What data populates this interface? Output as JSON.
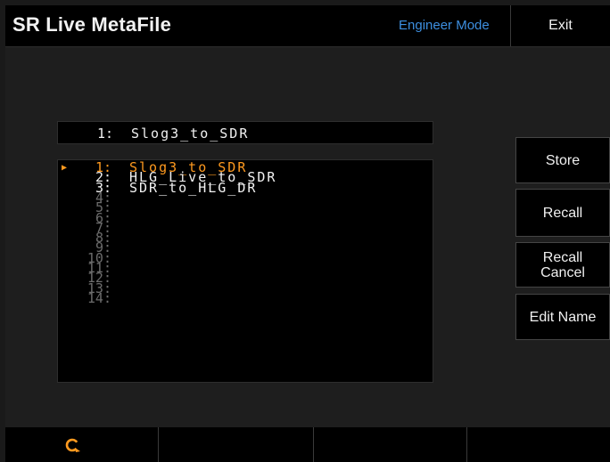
{
  "header": {
    "title": "SR Live MetaFile",
    "mode_label": "Engineer Mode",
    "exit_label": "Exit"
  },
  "current": {
    "number": "1:",
    "name": "Slog3_to_SDR"
  },
  "list": {
    "selected_index": 0,
    "rows": [
      {
        "number": "1:",
        "name": "Slog3_to_SDR"
      },
      {
        "number": "2:",
        "name": "HLG_Live_to_SDR"
      },
      {
        "number": "3:",
        "name": "SDR_to_HLG_DR"
      },
      {
        "number": "4:",
        "name": ""
      },
      {
        "number": "5:",
        "name": ""
      },
      {
        "number": "6:",
        "name": ""
      },
      {
        "number": "7:",
        "name": ""
      },
      {
        "number": "8:",
        "name": ""
      },
      {
        "number": "9:",
        "name": ""
      },
      {
        "number": "10:",
        "name": ""
      },
      {
        "number": "11:",
        "name": ""
      },
      {
        "number": "12:",
        "name": ""
      },
      {
        "number": "13:",
        "name": ""
      },
      {
        "number": "14:",
        "name": ""
      }
    ]
  },
  "side_buttons": {
    "store": "Store",
    "recall": "Recall",
    "recall_cancel_line1": "Recall",
    "recall_cancel_line2": "Cancel",
    "edit_name": "Edit Name"
  },
  "footer": {
    "refresh_icon": "refresh-icon",
    "accent_color": "#ff9a1f"
  },
  "colors": {
    "mode_text": "#3d8fe0",
    "selected": "#ff9a1f",
    "filled": "#f2f2f2",
    "empty": "#6c6c6c"
  }
}
